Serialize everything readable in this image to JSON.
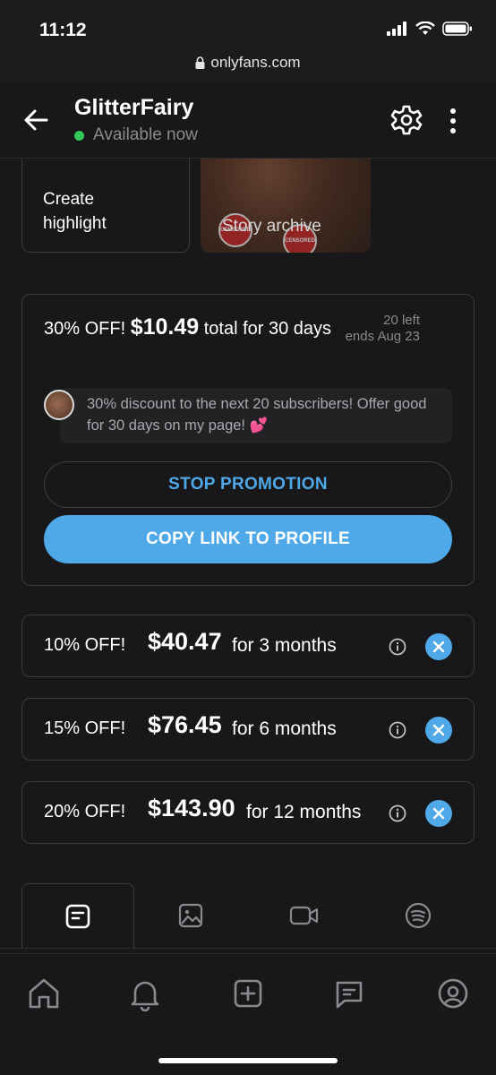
{
  "status_bar": {
    "time": "11:12",
    "url": "onlyfans.com"
  },
  "header": {
    "name": "GlitterFairy",
    "status": "Available now"
  },
  "highlights": {
    "create_label": "Create highlight",
    "archive_label": "Story archive",
    "sticker_text": "CENSORED"
  },
  "promo": {
    "discount": "30% OFF!",
    "price": "$10.49",
    "rest": "total for 30 days",
    "left": "20 left",
    "ends": "ends Aug 23",
    "message": "30% discount to the next 20 subscribers! Offer good for 30 days on my page! 💕",
    "stop_label": "STOP PROMOTION",
    "copy_label": "COPY LINK TO PROFILE"
  },
  "offers": [
    {
      "discount": "10% OFF!",
      "price": "$40.47",
      "duration": "for 3 months"
    },
    {
      "discount": "15% OFF!",
      "price": "$76.45",
      "duration": "for 6 months"
    },
    {
      "discount": "20% OFF!",
      "price": "$143.90",
      "duration": "for 12 months"
    }
  ],
  "tabs": [
    {
      "icon": "posts-icon",
      "active": true
    },
    {
      "icon": "photos-icon",
      "active": false
    },
    {
      "icon": "videos-icon",
      "active": false
    },
    {
      "icon": "audio-icon",
      "active": false
    }
  ],
  "nav": [
    "home-icon",
    "notifications-icon",
    "add-post-icon",
    "messages-icon",
    "profile-icon"
  ],
  "colors": {
    "accent": "#4fa9e8",
    "online": "#34c759",
    "background": "#18181a"
  }
}
